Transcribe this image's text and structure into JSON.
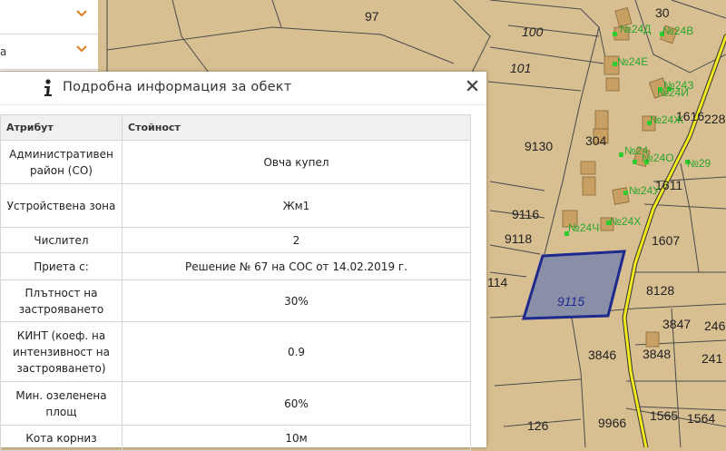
{
  "side_panel": {
    "rows": [
      {
        "label": "",
        "icon": "chevron-down-icon"
      },
      {
        "label": "а",
        "icon": "chevron-down-icon"
      }
    ]
  },
  "dialog": {
    "title": "Подробна информация за обект",
    "info_icon": "info-icon",
    "close_icon": "close-icon",
    "table": {
      "headers": [
        "Атрибут",
        "Стойност"
      ],
      "rows": [
        {
          "attr": "Административен район (СО)",
          "value": "Овча купел"
        },
        {
          "attr": "Устройствена зона",
          "value": "Жм1"
        },
        {
          "attr": "Числител",
          "value": "2"
        },
        {
          "attr": "Приета с:",
          "value": "Решение № 67 на СОС от 14.02.2019 г."
        },
        {
          "attr": "Плътност на застрояването",
          "value": "30%"
        },
        {
          "attr": "КИНТ (коеф. на интензивност на застрояването)",
          "value": "0.9"
        },
        {
          "attr": "Мин. озеленена площ",
          "value": "60%"
        },
        {
          "attr": "Кота корниз",
          "value": "10м"
        }
      ]
    }
  },
  "map": {
    "parcel_labels": [
      "97",
      "30",
      "100",
      "101",
      "9130",
      "9116",
      "9118",
      "114",
      "9115",
      "304",
      "1611",
      "1607",
      "8128",
      "3847",
      "246",
      "3846",
      "3848",
      "241",
      "126",
      "9966",
      "1565",
      "1564",
      "1616",
      "228"
    ],
    "building_labels": [
      "№24Д",
      "№24В",
      "№24Е",
      "№24З",
      "№24И",
      "№24Ж",
      "№24",
      "№24О",
      "№29",
      "№24У",
      "№24Ч",
      "№24Х"
    ],
    "colors": {
      "land": "#d8bf92",
      "parcel_line": "#444444",
      "selected_fill": "#8a8fa8",
      "selected_border": "#1f2a8f",
      "road": "#f3ea1e",
      "building": "#c9a064",
      "marker": "#2ecc2e",
      "label_green": "#2aa52a"
    }
  }
}
